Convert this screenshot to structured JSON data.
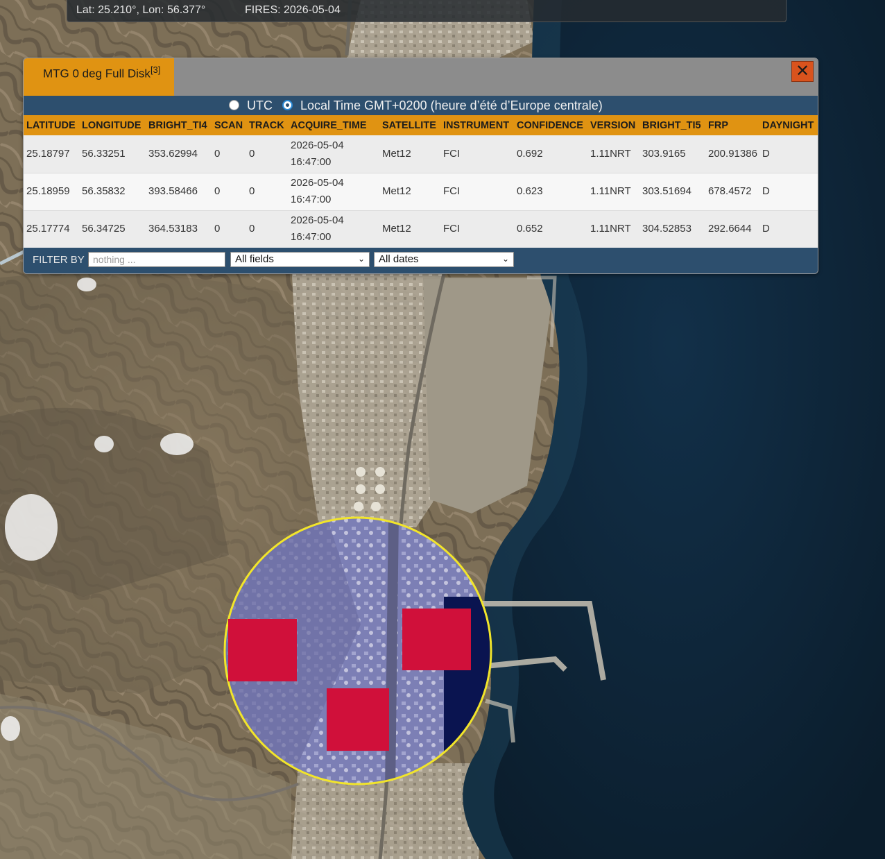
{
  "coord_bar": {
    "latlon": "Lat: 25.210°, Lon: 56.377°",
    "fires": "FIRES: 2026-05-04"
  },
  "panel": {
    "tab_label": "MTG 0 deg Full Disk",
    "tab_count": "[3]",
    "close_symbol": "✕",
    "time_options": {
      "utc": "UTC",
      "local": "Local Time GMT+0200 (heure d’été d’Europe centrale)",
      "selected": "local"
    },
    "columns": [
      "LATITUDE",
      "LONGITUDE",
      "BRIGHT_TI4",
      "SCAN",
      "TRACK",
      "ACQUIRE_TIME",
      "SATELLITE",
      "INSTRUMENT",
      "CONFIDENCE",
      "VERSION",
      "BRIGHT_TI5",
      "FRP",
      "DAYNIGHT"
    ],
    "rows": [
      {
        "latitude": "25.18797",
        "longitude": "56.33251",
        "bright_ti4": "353.62994",
        "scan": "0",
        "track": "0",
        "acquire_date": "2026-05-04",
        "acquire_time": "16:47:00",
        "satellite": "Met12",
        "instrument": "FCI",
        "confidence": "0.692",
        "version": "1.11NRT",
        "bright_ti5": "303.9165",
        "frp": "200.91386",
        "daynight": "D"
      },
      {
        "latitude": "25.18959",
        "longitude": "56.35832",
        "bright_ti4": "393.58466",
        "scan": "0",
        "track": "0",
        "acquire_date": "2026-05-04",
        "acquire_time": "16:47:00",
        "satellite": "Met12",
        "instrument": "FCI",
        "confidence": "0.623",
        "version": "1.11NRT",
        "bright_ti5": "303.51694",
        "frp": "678.4572",
        "daynight": "D"
      },
      {
        "latitude": "25.17774",
        "longitude": "56.34725",
        "bright_ti4": "364.53183",
        "scan": "0",
        "track": "0",
        "acquire_date": "2026-05-04",
        "acquire_time": "16:47:00",
        "satellite": "Met12",
        "instrument": "FCI",
        "confidence": "0.652",
        "version": "1.11NRT",
        "bright_ti5": "304.52853",
        "frp": "292.6644",
        "daynight": "D"
      }
    ],
    "filter": {
      "label": "FILTER BY",
      "placeholder": "nothing ...",
      "field_select": "All fields",
      "date_select": "All dates"
    }
  },
  "colors": {
    "accent_orange": "#e09312",
    "panel_blue": "#2d4f6e",
    "close_orange": "#d9531d",
    "fire_marker": "#d0103a",
    "highlight_circle": "#f2e52a",
    "sea": "#0e2233"
  }
}
